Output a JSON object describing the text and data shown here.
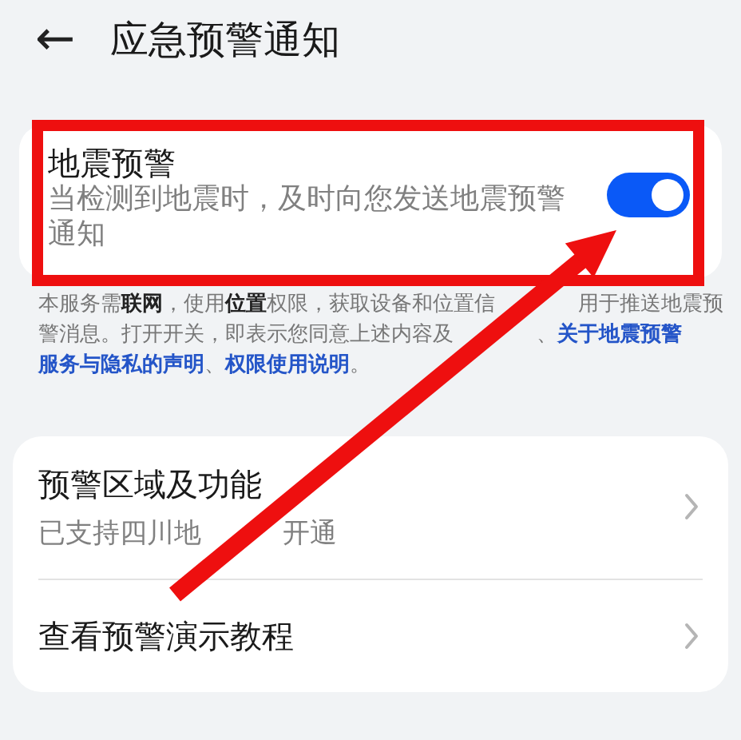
{
  "header": {
    "back": "←",
    "title": "应急预警通知"
  },
  "toggle_card": {
    "title": "地震预警",
    "subtitle": "当检测到地震时，及时向您发送地震预警通知",
    "on": true
  },
  "notice": [
    {
      "segments": [
        {
          "kind": "text",
          "text": "本服务需**联网**，使用**位置**权限，获取设备和位置信"
        },
        {
          "kind": "covered"
        },
        {
          "kind": "covered"
        },
        {
          "kind": "covered"
        },
        {
          "kind": "covered"
        },
        {
          "kind": "text",
          "text": "用于推送地震预"
        }
      ]
    },
    {
      "segments": [
        {
          "kind": "text",
          "text": "警消息。打开开关，即表示您同意上述内容及"
        },
        {
          "kind": "covered"
        },
        {
          "kind": "covered"
        },
        {
          "kind": "covered"
        },
        {
          "kind": "covered"
        },
        {
          "kind": "text",
          "text": "、"
        },
        {
          "kind": "link",
          "text": "关于地震预警"
        }
      ]
    },
    {
      "segments": [
        {
          "kind": "link",
          "text": "服务与隐私的声明"
        },
        {
          "kind": "text",
          "text": "、"
        },
        {
          "kind": "link",
          "text": "权限使用说明"
        },
        {
          "kind": "text",
          "text": "。"
        }
      ]
    }
  ],
  "list_items": [
    {
      "title": [
        {
          "kind": "text",
          "text": "预警区域及功能"
        }
      ],
      "subtitle": [
        {
          "kind": "text",
          "text": "已支持四川地"
        },
        {
          "kind": "covered"
        },
        {
          "kind": "covered"
        },
        {
          "kind": "covered"
        },
        {
          "kind": "text",
          "text": "开通"
        }
      ]
    },
    {
      "title": [
        {
          "kind": "text",
          "text": "查看预警演示教程"
        }
      ]
    }
  ]
}
